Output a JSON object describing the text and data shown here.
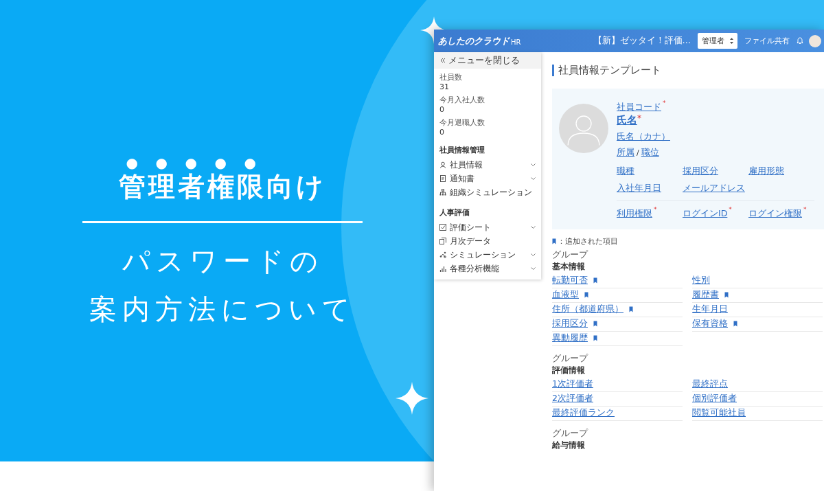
{
  "banner": {
    "title": [
      {
        "text": "管理者権限",
        "emphasis": true
      },
      {
        "text": "向け",
        "emphasis": false
      }
    ],
    "subtitle_lines": [
      "パスワードの",
      "案内方法について"
    ]
  },
  "app": {
    "header": {
      "logo": "あしたのクラウド",
      "logo_suffix": "HR",
      "notice": "【新】ゼッタイ！評価…",
      "role_select": "管理者",
      "file_share": "ファイル共有"
    },
    "sidebar": {
      "close_menu": "メニューを閉じる",
      "stats": [
        {
          "label": "社員数",
          "value": "31"
        },
        {
          "label": "今月入社人数",
          "value": "0"
        },
        {
          "label": "今月退職人数",
          "value": "0"
        }
      ],
      "sections": [
        {
          "title": "社員情報管理",
          "items": [
            {
              "label": "社員情報",
              "kind": "person",
              "expandable": true
            },
            {
              "label": "通知書",
              "kind": "document",
              "expandable": true
            },
            {
              "label": "組織シミュレーション",
              "kind": "org",
              "expandable": false
            }
          ]
        },
        {
          "title": "人事評価",
          "items": [
            {
              "label": "評価シート",
              "kind": "check",
              "expandable": true
            },
            {
              "label": "月次データ",
              "kind": "copy",
              "expandable": false
            },
            {
              "label": "シミュレーション",
              "kind": "nodes",
              "expandable": true
            },
            {
              "label": "各種分析機能",
              "kind": "chart",
              "expandable": true
            }
          ]
        }
      ]
    },
    "main": {
      "title": "社員情報テンプレート",
      "profile": {
        "code": {
          "label": "社員コード",
          "required_mark": "*"
        },
        "name": {
          "label": "氏名",
          "required_mark": "*"
        },
        "kana": "氏名（カナ）",
        "affiliation": "所属",
        "separator": "/",
        "position": "職位",
        "grid": [
          {
            "label": "職種"
          },
          {
            "label": "採用区分"
          },
          {
            "label": "雇用形態"
          },
          {
            "label": "入社年月日"
          },
          {
            "label": "メールアドレス"
          }
        ],
        "account": [
          {
            "label": "利用権限",
            "required_mark": "*"
          },
          {
            "label": "ログインID",
            "required_mark": "*"
          },
          {
            "label": "ログイン権限",
            "required_mark": "*"
          }
        ]
      },
      "legend": "：追加された項目",
      "groups": [
        {
          "caption": "グループ",
          "title": "基本情報",
          "fields": [
            {
              "label": "転勤可否",
              "added": true
            },
            {
              "label": "性別",
              "added": false
            },
            {
              "label": "血液型",
              "added": true
            },
            {
              "label": "履歴書",
              "added": true
            },
            {
              "label": "住所（都道府県）",
              "added": true
            },
            {
              "label": "生年月日",
              "added": false
            },
            {
              "label": "採用区分",
              "added": true
            },
            {
              "label": "保有資格",
              "added": true
            },
            {
              "label": "異動履歴",
              "added": true
            }
          ]
        },
        {
          "caption": "グループ",
          "title": "評価情報",
          "fields": [
            {
              "label": "1次評価者",
              "added": false
            },
            {
              "label": "最終評点",
              "added": false
            },
            {
              "label": "2次評価者",
              "added": false
            },
            {
              "label": "個別評価者",
              "added": false
            },
            {
              "label": "最終評価ランク",
              "added": false
            },
            {
              "label": "閲覧可能社員",
              "added": false
            }
          ]
        },
        {
          "caption": "グループ",
          "title": "給与情報"
        }
      ]
    }
  }
}
